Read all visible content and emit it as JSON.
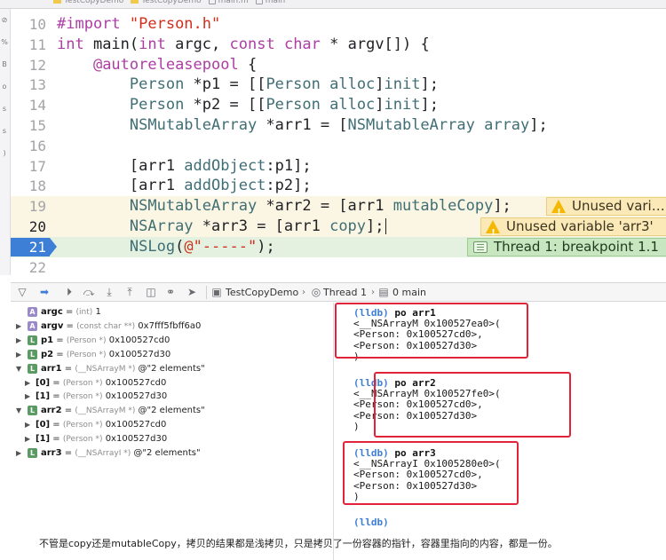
{
  "breadcrumbs": [
    "TestCopyDemo",
    "TestCopyDemo",
    "main.m",
    "main"
  ],
  "navigator_glyphs": [
    "⊘",
    "%",
    "B",
    "o",
    "s",
    "s",
    ")"
  ],
  "code_lines": [
    {
      "num": "10",
      "tokens": [
        {
          "t": "#import ",
          "c": "kw"
        },
        {
          "t": "\"Person.h\"",
          "c": "str"
        }
      ]
    },
    {
      "num": "11",
      "tokens": [
        {
          "t": "int",
          "c": "kw"
        },
        {
          "t": " main(",
          "c": ""
        },
        {
          "t": "int",
          "c": "kw"
        },
        {
          "t": " argc, ",
          "c": ""
        },
        {
          "t": "const",
          "c": "kw"
        },
        {
          "t": " ",
          "c": ""
        },
        {
          "t": "char",
          "c": "kw"
        },
        {
          "t": " * argv[]) {",
          "c": ""
        }
      ]
    },
    {
      "num": "12",
      "tokens": [
        {
          "t": "    ",
          "c": ""
        },
        {
          "t": "@autoreleasepool",
          "c": "kw"
        },
        {
          "t": " {",
          "c": ""
        }
      ]
    },
    {
      "num": "13",
      "tokens": [
        {
          "t": "        ",
          "c": ""
        },
        {
          "t": "Person",
          "c": "cls"
        },
        {
          "t": " *p1 = [[",
          "c": ""
        },
        {
          "t": "Person",
          "c": "cls"
        },
        {
          "t": " ",
          "c": ""
        },
        {
          "t": "alloc",
          "c": "mth"
        },
        {
          "t": "]",
          "c": ""
        },
        {
          "t": "init",
          "c": "mth"
        },
        {
          "t": "];",
          "c": ""
        }
      ]
    },
    {
      "num": "14",
      "tokens": [
        {
          "t": "        ",
          "c": ""
        },
        {
          "t": "Person",
          "c": "cls"
        },
        {
          "t": " *p2 = [[",
          "c": ""
        },
        {
          "t": "Person",
          "c": "cls"
        },
        {
          "t": " ",
          "c": ""
        },
        {
          "t": "alloc",
          "c": "mth"
        },
        {
          "t": "]",
          "c": ""
        },
        {
          "t": "init",
          "c": "mth"
        },
        {
          "t": "];",
          "c": ""
        }
      ]
    },
    {
      "num": "15",
      "tokens": [
        {
          "t": "        ",
          "c": ""
        },
        {
          "t": "NSMutableArray",
          "c": "cls"
        },
        {
          "t": " *arr1 = [",
          "c": ""
        },
        {
          "t": "NSMutableArray",
          "c": "cls"
        },
        {
          "t": " ",
          "c": ""
        },
        {
          "t": "array",
          "c": "mth"
        },
        {
          "t": "];",
          "c": ""
        }
      ]
    },
    {
      "num": "16",
      "tokens": []
    },
    {
      "num": "17",
      "tokens": [
        {
          "t": "        [arr1 ",
          "c": ""
        },
        {
          "t": "addObject",
          "c": "mth"
        },
        {
          "t": ":p1];",
          "c": ""
        }
      ]
    },
    {
      "num": "18",
      "tokens": [
        {
          "t": "        [arr1 ",
          "c": ""
        },
        {
          "t": "addObject",
          "c": "mth"
        },
        {
          "t": ":p2];",
          "c": ""
        }
      ]
    },
    {
      "num": "19",
      "tokens": [
        {
          "t": "        ",
          "c": ""
        },
        {
          "t": "NSMutableArray",
          "c": "cls"
        },
        {
          "t": " *arr2 = [arr1 ",
          "c": ""
        },
        {
          "t": "mutableCopy",
          "c": "mth"
        },
        {
          "t": "];",
          "c": ""
        }
      ]
    },
    {
      "num": "20",
      "tokens": [
        {
          "t": "        ",
          "c": ""
        },
        {
          "t": "NSArray",
          "c": "cls"
        },
        {
          "t": " *arr3 = [arr1 ",
          "c": ""
        },
        {
          "t": "copy",
          "c": "mth"
        },
        {
          "t": "];",
          "c": ""
        }
      ]
    },
    {
      "num": "21",
      "tokens": [
        {
          "t": "        ",
          "c": ""
        },
        {
          "t": "NSLog",
          "c": "mth"
        },
        {
          "t": "(",
          "c": ""
        },
        {
          "t": "@\"-----\"",
          "c": "str"
        },
        {
          "t": ");",
          "c": ""
        }
      ]
    },
    {
      "num": "22",
      "tokens": []
    }
  ],
  "warnings": {
    "line19": "Unused vari…",
    "line20": "Unused variable 'arr3'",
    "line21": "Thread 1: breakpoint 1.1"
  },
  "debug_bar": {
    "target": "TestCopyDemo",
    "thread": "Thread 1",
    "frame": "0 main"
  },
  "variables": [
    {
      "indent": 0,
      "tri": "",
      "icon": "A",
      "name": "argc",
      "type": "(int)",
      "value": "1"
    },
    {
      "indent": 0,
      "tri": "▶",
      "icon": "A",
      "name": "argv",
      "type": "(const char **)",
      "value": "0x7fff5fbff6a0"
    },
    {
      "indent": 0,
      "tri": "▶",
      "icon": "L",
      "name": "p1",
      "type": "(Person *)",
      "value": "0x100527cd0"
    },
    {
      "indent": 0,
      "tri": "▶",
      "icon": "L",
      "name": "p2",
      "type": "(Person *)",
      "value": "0x100527d30"
    },
    {
      "indent": 0,
      "tri": "▼",
      "icon": "L",
      "name": "arr1",
      "type": "(__NSArrayM *)",
      "value": "@\"2 elements\""
    },
    {
      "indent": 1,
      "tri": "▶",
      "icon": "",
      "name": "[0]",
      "type": "(Person *)",
      "value": "0x100527cd0"
    },
    {
      "indent": 1,
      "tri": "▶",
      "icon": "",
      "name": "[1]",
      "type": "(Person *)",
      "value": "0x100527d30"
    },
    {
      "indent": 0,
      "tri": "▼",
      "icon": "L",
      "name": "arr2",
      "type": "(__NSArrayM *)",
      "value": "@\"2 elements\""
    },
    {
      "indent": 1,
      "tri": "▶",
      "icon": "",
      "name": "[0]",
      "type": "(Person *)",
      "value": "0x100527cd0"
    },
    {
      "indent": 1,
      "tri": "▶",
      "icon": "",
      "name": "[1]",
      "type": "(Person *)",
      "value": "0x100527d30"
    },
    {
      "indent": 0,
      "tri": "▶",
      "icon": "L",
      "name": "arr3",
      "type": "(__NSArrayI *)",
      "value": "@\"2 elements\""
    }
  ],
  "console": {
    "prompt": "(lldb)",
    "blocks": [
      {
        "cmd": "po arr1",
        "output": [
          "<__NSArrayM 0x100527ea0>(",
          "<Person: 0x100527cd0>,",
          "<Person: 0x100527d30>",
          ")"
        ]
      },
      {
        "cmd": "po arr2",
        "output": [
          "<__NSArrayM 0x100527fe0>(",
          "<Person: 0x100527cd0>,",
          "<Person: 0x100527d30>",
          ")"
        ]
      },
      {
        "cmd": "po arr3",
        "output": [
          "<__NSArrayI 0x1005280e0>(",
          "<Person: 0x100527cd0>,",
          "<Person: 0x100527d30>",
          ")"
        ]
      }
    ],
    "trailing_prompt": "(lldb)"
  },
  "note": "不管是copy还是mutableCopy，拷贝的结果都是浅拷贝，只是拷贝了一份容器的指针，容器里指向的内容，都是一份。",
  "colors": {
    "breakpoint": "#3d7fd6",
    "highlight_box": "#e2243b",
    "keyword": "#ad3da4",
    "string": "#d12f1b",
    "class": "#3f6e74"
  }
}
